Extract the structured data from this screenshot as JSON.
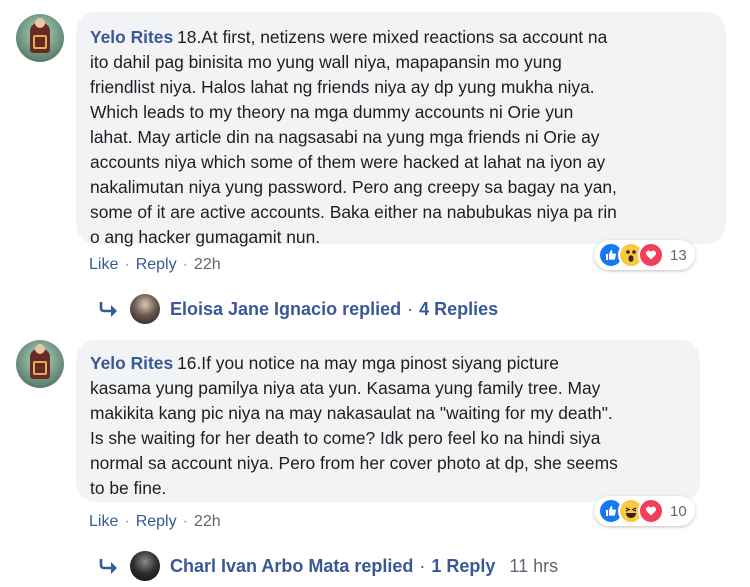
{
  "comments": [
    {
      "author": "Yelo Rites",
      "text": "18.At first, netizens were mixed reactions sa account na\nito dahil pag binisita mo yung wall niya, mapapansin mo yung\nfriendlist niya. Halos lahat ng friends niya ay dp yung mukha niya.\nWhich leads to my theory na mga dummy accounts ni Orie yun\nlahat. May article din na nagsasabi na yung mga friends ni Orie ay\naccounts niya which some of them were hacked at lahat na iyon ay\nnakalimutan niya yung password. Pero ang creepy sa bagay na yan,\nsome of it are active accounts. Baka either na nabubukas niya pa rin\no ang hacker gumagamit nun.",
      "reactions": {
        "icons": [
          "like-icon",
          "wow-icon",
          "love-icon"
        ],
        "count": "13"
      },
      "actions": {
        "like": "Like",
        "reply": "Reply",
        "time": "22h"
      },
      "replies": {
        "name": "Eloisa Jane Ignacio replied",
        "count": "4 Replies",
        "time": ""
      }
    },
    {
      "author": "Yelo Rites",
      "text": "16.If you notice na may mga pinost siyang picture\nkasama yung pamilya niya ata yun. Kasama yung family tree. May\nmakikita kang pic niya na may nakasaulat na \"waiting for my death\".\nIs she waiting for her death to come? Idk pero feel ko na hindi siya\nnormal sa account niya. Pero from her cover photo at dp, she seems\nto be fine.",
      "reactions": {
        "icons": [
          "like-icon",
          "haha-icon",
          "love-icon"
        ],
        "count": "10"
      },
      "actions": {
        "like": "Like",
        "reply": "Reply",
        "time": "22h"
      },
      "replies": {
        "name": "Charl Ivan Arbo Mata replied",
        "count": "1 Reply",
        "time": "11 hrs"
      }
    }
  ],
  "colors": {
    "link": "#385898",
    "bubble": "#f2f3f5",
    "like": "#1877f2",
    "love": "#f33e58",
    "wow": "#f7c944"
  }
}
